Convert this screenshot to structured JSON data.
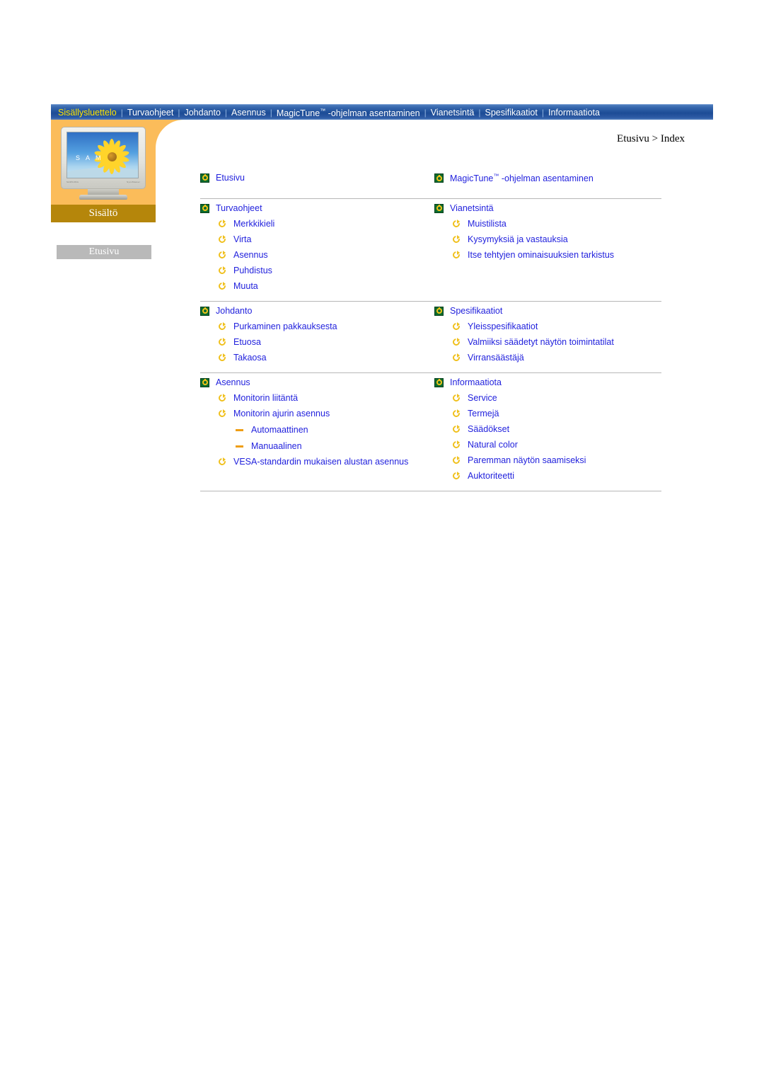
{
  "nav": {
    "items": [
      {
        "label": "Sisällysluettelo",
        "active": true
      },
      {
        "label": "Turvaohjeet",
        "active": false
      },
      {
        "label": "Johdanto",
        "active": false
      },
      {
        "label": "Asennus",
        "active": false
      },
      {
        "label": "MagicTune™ -ohjelman asentaminen",
        "active": false
      },
      {
        "label": "Vianetsintä",
        "active": false
      },
      {
        "label": "Spesifikaatiot",
        "active": false
      },
      {
        "label": "Informaatiota",
        "active": false
      }
    ],
    "separator": "|"
  },
  "sidebar": {
    "monitor_brand": "SAMSUNG",
    "monitor_model": "SyncMaster",
    "screen_text": "S A M",
    "banner_label": "Sisältö",
    "home_button_label": "Etusivu"
  },
  "breadcrumb": {
    "text": "Etusivu > Index"
  },
  "groups": [
    {
      "left": {
        "top": "Etusivu",
        "subs": []
      },
      "right": {
        "top": "MagicTune™ -ohjelman asentaminen",
        "subs": []
      }
    },
    {
      "left": {
        "top": "Turvaohjeet",
        "subs": [
          {
            "label": "Merkkikieli"
          },
          {
            "label": "Virta"
          },
          {
            "label": "Asennus"
          },
          {
            "label": "Puhdistus"
          },
          {
            "label": "Muuta"
          }
        ]
      },
      "right": {
        "top": "Vianetsintä",
        "subs": [
          {
            "label": "Muistilista"
          },
          {
            "label": "Kysymyksiä ja vastauksia"
          },
          {
            "label": "Itse tehtyjen ominaisuuksien tarkistus"
          }
        ]
      }
    },
    {
      "left": {
        "top": "Johdanto",
        "subs": [
          {
            "label": "Purkaminen pakkauksesta"
          },
          {
            "label": "Etuosa"
          },
          {
            "label": "Takaosa"
          }
        ]
      },
      "right": {
        "top": "Spesifikaatiot",
        "subs": [
          {
            "label": "Yleisspesifikaatiot"
          },
          {
            "label": "Valmiiksi säädetyt näytön toimintatilat"
          },
          {
            "label": "Virransäästäjä"
          }
        ]
      }
    },
    {
      "left": {
        "top": "Asennus",
        "subs": [
          {
            "label": "Monitorin liitäntä"
          },
          {
            "label": "Monitorin ajurin asennus",
            "children": [
              {
                "label": "Automaattinen"
              },
              {
                "label": "Manuaalinen"
              }
            ]
          },
          {
            "label": "VESA-standardin mukaisen alustan asennus"
          }
        ]
      },
      "right": {
        "top": "Informaatiota",
        "subs": [
          {
            "label": "Service"
          },
          {
            "label": "Termejä"
          },
          {
            "label": "Säädökset"
          },
          {
            "label": "Natural color"
          },
          {
            "label": "Paremman näytön saamiseksi"
          },
          {
            "label": "Auktoriteetti"
          }
        ]
      }
    }
  ],
  "colors": {
    "nav_bar": "#1c4c96",
    "nav_active_text": "#ffe400",
    "sidebar_panel": "#fbbc5a",
    "sisalto_bar": "#b5860b",
    "link_text": "#2222dd",
    "icon_green": "#0b6b2e",
    "icon_gold": "#f0c01c",
    "dash_orange": "#ef9e13"
  }
}
